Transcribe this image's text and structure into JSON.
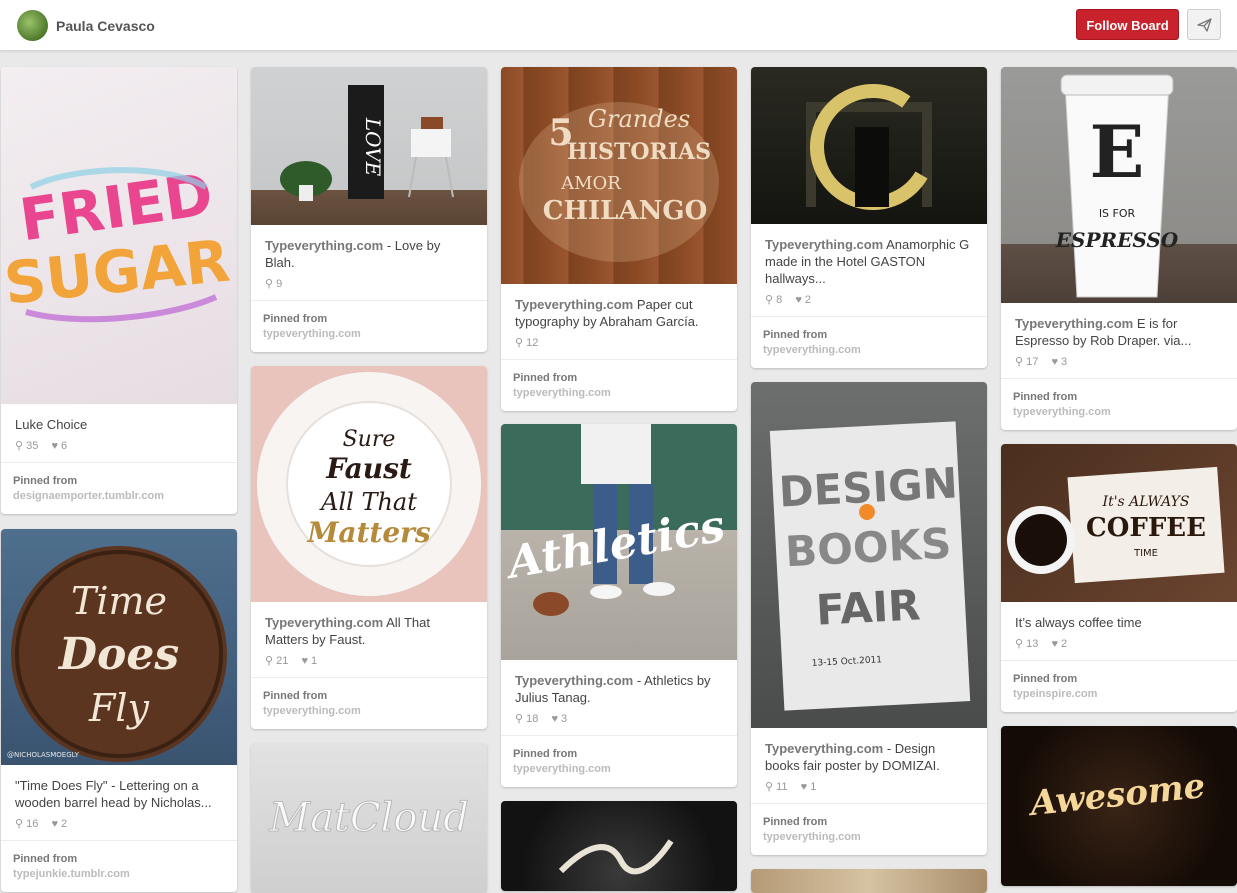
{
  "header": {
    "owner_name": "Paula Cevasco",
    "follow_label": "Follow Board"
  },
  "pins": {
    "c1a": {
      "title": "",
      "desc": "Luke Choice",
      "repins": "35",
      "likes": "6",
      "pinned_label": "Pinned from",
      "domain": "designaemporter.tumblr.com"
    },
    "c1b": {
      "title": "",
      "desc": "\"Time Does Fly\" - Lettering on a wooden barrel head by Nicholas...",
      "repins": "16",
      "likes": "2",
      "pinned_label": "Pinned from",
      "domain": "typejunkie.tumblr.com"
    },
    "c2a": {
      "title": "Typeverything.com",
      "desc": " - Love by Blah.",
      "repins": "9",
      "likes": "",
      "pinned_label": "Pinned from",
      "domain": "typeverything.com"
    },
    "c2b": {
      "title": "Typeverything.com",
      "desc": " All That Matters by Faust.",
      "repins": "21",
      "likes": "1",
      "pinned_label": "Pinned from",
      "domain": "typeverything.com"
    },
    "c3a": {
      "title": "Typeverything.com",
      "desc": " Paper cut typography by Abraham García.",
      "repins": "12",
      "likes": "",
      "pinned_label": "Pinned from",
      "domain": "typeverything.com"
    },
    "c3b": {
      "title": "Typeverything.com",
      "desc": " - Athletics by Julius Tanag.",
      "repins": "18",
      "likes": "3",
      "pinned_label": "Pinned from",
      "domain": "typeverything.com"
    },
    "c4a": {
      "title": "Typeverything.com",
      "desc": " Anamorphic G made in the Hotel GASTON hallways...",
      "repins": "8",
      "likes": "2",
      "pinned_label": "Pinned from",
      "domain": "typeverything.com"
    },
    "c4b": {
      "title": "Typeverything.com",
      "desc": " - Design books fair poster by DOMIZAI.",
      "repins": "11",
      "likes": "1",
      "pinned_label": "Pinned from",
      "domain": "typeverything.com"
    },
    "c5a": {
      "title": "Typeverything.com",
      "desc": " E is for Espresso by Rob Draper. via...",
      "repins": "17",
      "likes": "3",
      "pinned_label": "Pinned from",
      "domain": "typeverything.com"
    },
    "c5b": {
      "title": "",
      "desc": "It’s always coffee time",
      "repins": "13",
      "likes": "2",
      "pinned_label": "Pinned from",
      "domain": "typeinspire.com"
    }
  },
  "artwork_text": {
    "fried": "FRIED",
    "sugar": "SUGAR",
    "time": "Time",
    "does": "Does",
    "fly": "Fly",
    "credit": "@NICHOLASMOEGLY",
    "love": "LOVE",
    "sure": "Sure",
    "faust": "Faust",
    "allthat": "All That",
    "matters": "Matters",
    "cinco": "5",
    "grandes": "Grandes",
    "historias": "HISTORIAS",
    "amor": "AMOR",
    "chilango": "CHILANGO",
    "athletics": "Athletics",
    "design": "DESIGN",
    "books": "BOOKS",
    "fair": "FAIR",
    "dates": "13-15 Oct.2011",
    "e": "E",
    "isfor": "IS FOR",
    "espresso": "ESPRESSO",
    "itsalways": "It's ALWAYS",
    "coffee": "COFFEE",
    "timesm": "TIME",
    "matcloud": "MatCloud",
    "awesome": "Awesome"
  },
  "colors": {
    "brand_red": "#c8232c",
    "background": "#e9e9e9"
  },
  "icons": {
    "repin": "pin-icon",
    "like": "heart-icon",
    "send": "paper-plane-icon"
  }
}
